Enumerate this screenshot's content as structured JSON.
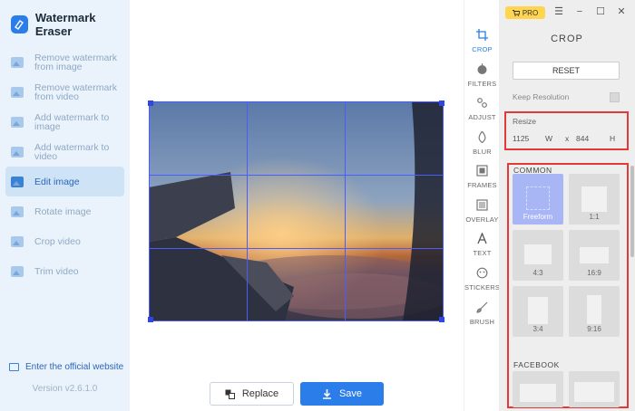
{
  "app": {
    "name": "Watermark Eraser"
  },
  "sidebar": {
    "items": [
      {
        "label": "Remove watermark from image",
        "active": false
      },
      {
        "label": "Remove watermark from video",
        "active": false
      },
      {
        "label": "Add watermark to image",
        "active": false
      },
      {
        "label": "Add watermark to video",
        "active": false
      },
      {
        "label": "Edit image",
        "active": true
      },
      {
        "label": "Rotate image",
        "active": false
      },
      {
        "label": "Crop video",
        "active": false
      },
      {
        "label": "Trim video",
        "active": false
      }
    ],
    "website_label": "Enter the official website",
    "version": "Version v2.6.1.0"
  },
  "canvas": {
    "replace_label": "Replace",
    "save_label": "Save"
  },
  "window": {
    "pro_label": "PRO"
  },
  "tools": [
    {
      "label": "CROP",
      "icon": "crop-icon",
      "active": true
    },
    {
      "label": "FILTERS",
      "icon": "filters-icon",
      "active": false
    },
    {
      "label": "ADJUST",
      "icon": "adjust-icon",
      "active": false
    },
    {
      "label": "BLUR",
      "icon": "blur-icon",
      "active": false
    },
    {
      "label": "FRAMES",
      "icon": "frames-icon",
      "active": false
    },
    {
      "label": "OVERLAY",
      "icon": "overlay-icon",
      "active": false
    },
    {
      "label": "TEXT",
      "icon": "text-icon",
      "active": false
    },
    {
      "label": "STICKERS",
      "icon": "stickers-icon",
      "active": false
    },
    {
      "label": "BRUSH",
      "icon": "brush-icon",
      "active": false
    }
  ],
  "panel": {
    "title": "CROP",
    "reset_label": "RESET",
    "keep_resolution_label": "Keep Resolution",
    "resize_label": "Resize",
    "width_value": "1125",
    "width_unit": "W",
    "times": "x",
    "height_value": "844",
    "height_unit": "H",
    "common_label": "COMMON",
    "presets": [
      {
        "label": "Freeform",
        "selected": true
      },
      {
        "label": "1:1",
        "selected": false
      },
      {
        "label": "4:3",
        "selected": false
      },
      {
        "label": "16:9",
        "selected": false
      },
      {
        "label": "3:4",
        "selected": false
      },
      {
        "label": "9:16",
        "selected": false
      }
    ],
    "facebook_label": "FACEBOOK"
  },
  "colors": {
    "accent": "#2b7de9",
    "highlight": "#e53935",
    "crop_grid": "#4b5cff"
  }
}
